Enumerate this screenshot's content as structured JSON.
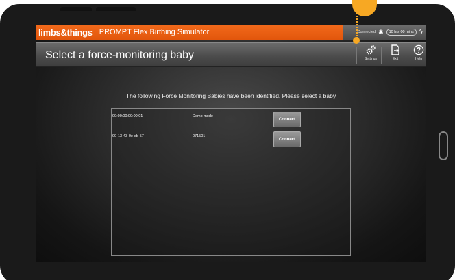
{
  "app": {
    "brand": "limbs&things",
    "title": "PROMPT Flex Birthing Simulator"
  },
  "status": {
    "connection": "Connected",
    "timer": "10 hrs 00 mins"
  },
  "header": {
    "page_title": "Select a force-monitoring baby",
    "settings_label": "Settings",
    "exit_label": "Exit",
    "help_label": "Help"
  },
  "main": {
    "instruction": "The following Force Monitoring Babies have been identified. Please select a baby",
    "devices": [
      {
        "address": "00:00:00:00:00:01",
        "name": "Demo mode",
        "action": "Connect"
      },
      {
        "address": "00-13-43-0e-eb-57",
        "name": "071501",
        "action": "Connect"
      }
    ]
  },
  "colors": {
    "brand_orange": "#f26a1b",
    "callout": "#f7a823"
  },
  "icons": [
    "bluetooth-icon",
    "bolt-icon",
    "gears-icon",
    "exit-icon",
    "help-icon"
  ]
}
